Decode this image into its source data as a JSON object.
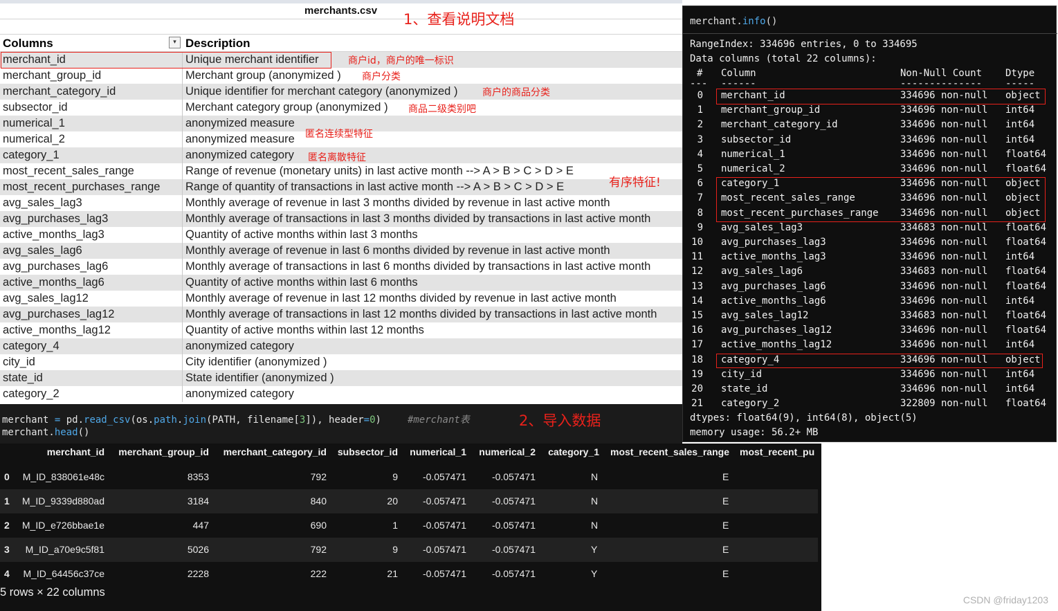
{
  "sheet": {
    "title": "merchants.csv",
    "headers": [
      "Columns",
      "Description"
    ],
    "filter_symbol": "▾",
    "rows": [
      [
        "merchant_id",
        "Unique merchant identifier"
      ],
      [
        "merchant_group_id",
        "Merchant group (anonymized )"
      ],
      [
        "merchant_category_id",
        "Unique identifier for merchant category (anonymized )"
      ],
      [
        "subsector_id",
        "Merchant category group (anonymized )"
      ],
      [
        "numerical_1",
        "anonymized measure"
      ],
      [
        "numerical_2",
        "anonymized measure"
      ],
      [
        "category_1",
        "anonymized category"
      ],
      [
        "most_recent_sales_range",
        "Range of revenue (monetary units) in last active month --> A > B > C > D > E"
      ],
      [
        "most_recent_purchases_range",
        "Range of quantity of transactions in last active month --> A > B > C > D > E"
      ],
      [
        "avg_sales_lag3",
        "Monthly average of revenue in last 3 months divided by revenue in last active month"
      ],
      [
        "avg_purchases_lag3",
        "Monthly average of transactions in last 3 months divided by transactions in last active month"
      ],
      [
        "active_months_lag3",
        "Quantity of active months within last 3 months"
      ],
      [
        "avg_sales_lag6",
        "Monthly average of revenue in last 6 months divided by revenue in last active month"
      ],
      [
        "avg_purchases_lag6",
        "Monthly average of transactions in last 6 months divided by transactions in last active month"
      ],
      [
        "active_months_lag6",
        "Quantity of active months within last 6 months"
      ],
      [
        "avg_sales_lag12",
        "Monthly average of revenue in last 12 months divided by revenue in last active month"
      ],
      [
        "avg_purchases_lag12",
        "Monthly average of transactions in last 12 months divided by transactions in last active month"
      ],
      [
        "active_months_lag12",
        "Quantity of active months within last 12 months"
      ],
      [
        "category_4",
        "anonymized category"
      ],
      [
        "city_id",
        "City identifier (anonymized )"
      ],
      [
        "state_id",
        "State identifier (anonymized )"
      ],
      [
        "category_2",
        "anonymized category"
      ]
    ]
  },
  "annotations": {
    "step1": "1、查看说明文档",
    "merchant_id": "商户id，商户的唯一标识",
    "group": "商户分类",
    "category": "商户的商品分类",
    "subsector": "商品二级类别吧",
    "numerical": "匿名连续型特征",
    "category_1": "匿名离散特征",
    "ordered": "有序特征!",
    "step2": "2、导入数据"
  },
  "info": {
    "call_obj": "merchant.",
    "call_fn": "info",
    "call_paren": "()",
    "range_index": "RangeIndex: 334696 entries, 0 to 334695",
    "data_columns": "Data columns (total 22 columns):",
    "headers": {
      "num": "#",
      "column": "Column",
      "count": "Non-Null Count",
      "dtype": "Dtype"
    },
    "underline": {
      "num": "---",
      "column": "------",
      "count": "--------------",
      "dtype": "-----"
    },
    "rows": [
      [
        "0",
        "merchant_id",
        "334696 non-null",
        "object"
      ],
      [
        "1",
        "merchant_group_id",
        "334696 non-null",
        "int64"
      ],
      [
        "2",
        "merchant_category_id",
        "334696 non-null",
        "int64"
      ],
      [
        "3",
        "subsector_id",
        "334696 non-null",
        "int64"
      ],
      [
        "4",
        "numerical_1",
        "334696 non-null",
        "float64"
      ],
      [
        "5",
        "numerical_2",
        "334696 non-null",
        "float64"
      ],
      [
        "6",
        "category_1",
        "334696 non-null",
        "object"
      ],
      [
        "7",
        "most_recent_sales_range",
        "334696 non-null",
        "object"
      ],
      [
        "8",
        "most_recent_purchases_range",
        "334696 non-null",
        "object"
      ],
      [
        "9",
        "avg_sales_lag3",
        "334683 non-null",
        "float64"
      ],
      [
        "10",
        "avg_purchases_lag3",
        "334696 non-null",
        "float64"
      ],
      [
        "11",
        "active_months_lag3",
        "334696 non-null",
        "int64"
      ],
      [
        "12",
        "avg_sales_lag6",
        "334683 non-null",
        "float64"
      ],
      [
        "13",
        "avg_purchases_lag6",
        "334696 non-null",
        "float64"
      ],
      [
        "14",
        "active_months_lag6",
        "334696 non-null",
        "int64"
      ],
      [
        "15",
        "avg_sales_lag12",
        "334683 non-null",
        "float64"
      ],
      [
        "16",
        "avg_purchases_lag12",
        "334696 non-null",
        "float64"
      ],
      [
        "17",
        "active_months_lag12",
        "334696 non-null",
        "int64"
      ],
      [
        "18",
        "category_4",
        "334696 non-null",
        "object"
      ],
      [
        "19",
        "city_id",
        "334696 non-null",
        "int64"
      ],
      [
        "20",
        "state_id",
        "334696 non-null",
        "int64"
      ],
      [
        "21",
        "category_2",
        "322809 non-null",
        "float64"
      ]
    ],
    "dtypes": "dtypes: float64(9), int64(8), object(5)",
    "memory": "memory usage: 56.2+ MB"
  },
  "code": {
    "l1_a": "merchant ",
    "l1_eq": "=",
    "l1_b": " pd.",
    "l1_fn": "read_csv",
    "l1_c": "(os.",
    "l1_path": "path",
    "l1_d": ".",
    "l1_join": "join",
    "l1_e": "(PATH, filename[",
    "l1_idx": "3",
    "l1_f": "]), header",
    "l1_eq2": "=",
    "l1_zero": "0",
    "l1_g": ")",
    "l1_comment": "#merchant表",
    "l2_a": "merchant.",
    "l2_fn": "head",
    "l2_b": "()"
  },
  "dataframe": {
    "columns": [
      "merchant_id",
      "merchant_group_id",
      "merchant_category_id",
      "subsector_id",
      "numerical_1",
      "numerical_2",
      "category_1",
      "most_recent_sales_range",
      "most_recent_pu"
    ],
    "rows": [
      [
        "0",
        "M_ID_838061e48c",
        "8353",
        "792",
        "9",
        "-0.057471",
        "-0.057471",
        "N",
        "E"
      ],
      [
        "1",
        "M_ID_9339d880ad",
        "3184",
        "840",
        "20",
        "-0.057471",
        "-0.057471",
        "N",
        "E"
      ],
      [
        "2",
        "M_ID_e726bbae1e",
        "447",
        "690",
        "1",
        "-0.057471",
        "-0.057471",
        "N",
        "E"
      ],
      [
        "3",
        "M_ID_a70e9c5f81",
        "5026",
        "792",
        "9",
        "-0.057471",
        "-0.057471",
        "Y",
        "E"
      ],
      [
        "4",
        "M_ID_64456c37ce",
        "2228",
        "222",
        "21",
        "-0.057471",
        "-0.057471",
        "Y",
        "E"
      ]
    ],
    "footer": "5 rows × 22 columns"
  },
  "watermark": "CSDN @friday1203",
  "colors": {
    "annotation_red": "#e8211b",
    "console_bg": "#0f0f0f",
    "keyword_blue": "#4fa8e8"
  }
}
